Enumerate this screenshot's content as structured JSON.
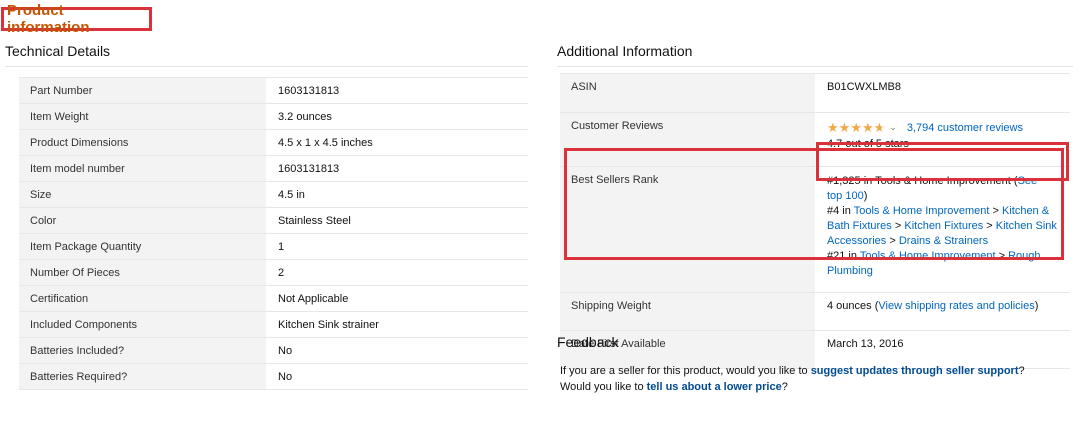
{
  "header": {
    "title": "Product information"
  },
  "technical": {
    "title": "Technical Details",
    "rows": [
      {
        "label": "Part Number",
        "value": "1603131813"
      },
      {
        "label": "Item Weight",
        "value": "3.2 ounces"
      },
      {
        "label": "Product Dimensions",
        "value": "4.5 x 1 x 4.5 inches"
      },
      {
        "label": "Item model number",
        "value": "1603131813"
      },
      {
        "label": "Size",
        "value": "4.5 in"
      },
      {
        "label": "Color",
        "value": "Stainless Steel"
      },
      {
        "label": "Item Package Quantity",
        "value": "1"
      },
      {
        "label": "Number Of Pieces",
        "value": "2"
      },
      {
        "label": "Certification",
        "value": "Not Applicable"
      },
      {
        "label": "Included Components",
        "value": "Kitchen Sink strainer"
      },
      {
        "label": "Batteries Included?",
        "value": "No"
      },
      {
        "label": "Batteries Required?",
        "value": "No"
      }
    ]
  },
  "additional": {
    "title": "Additional Information",
    "asin_label": "ASIN",
    "asin_value": "B01CWXLMB8",
    "reviews_label": "Customer Reviews",
    "rating": 4.7,
    "stars_text": "★★★★★",
    "reviews_link": "3,794 customer reviews",
    "rating_text": "4.7 out of 5 stars",
    "rank_label": "Best Sellers Rank",
    "rank1_prefix": "#1,325 in Tools & Home Improvement (",
    "rank1_link": "See top 100",
    "rank1_suffix": ")",
    "rank2_prefix": "#4 in ",
    "rank2_links": [
      "Tools & Home Improvement",
      "Kitchen & Bath Fixtures",
      "Kitchen Fixtures",
      "Kitchen Sink Accessories",
      "Drains & Strainers"
    ],
    "rank3_prefix": "#21 in ",
    "rank3_links": [
      "Tools & Home Improvement",
      "Rough Plumbing"
    ],
    "separator": " > ",
    "shipping_label": "Shipping Weight",
    "shipping_value": "4 ounces (",
    "shipping_link": "View shipping rates and policies",
    "shipping_suffix": ")",
    "date_label": "Date First Available",
    "date_value": "March 13, 2016"
  },
  "feedback": {
    "title": "Feedback",
    "line1_prefix": "If you are a seller for this product, would you like to ",
    "line1_link": "suggest updates through seller support",
    "line1_suffix": "?",
    "line2_prefix": "Would you like to ",
    "line2_link": "tell us about a lower price",
    "line2_suffix": "?"
  },
  "colors": {
    "highlight": "#d9323a",
    "link": "#0066c0",
    "header_orange": "#c45500",
    "star": "#f3a847"
  },
  "icons": {
    "chevron": "chevron-down-icon",
    "stars": "star-rating-icon"
  }
}
